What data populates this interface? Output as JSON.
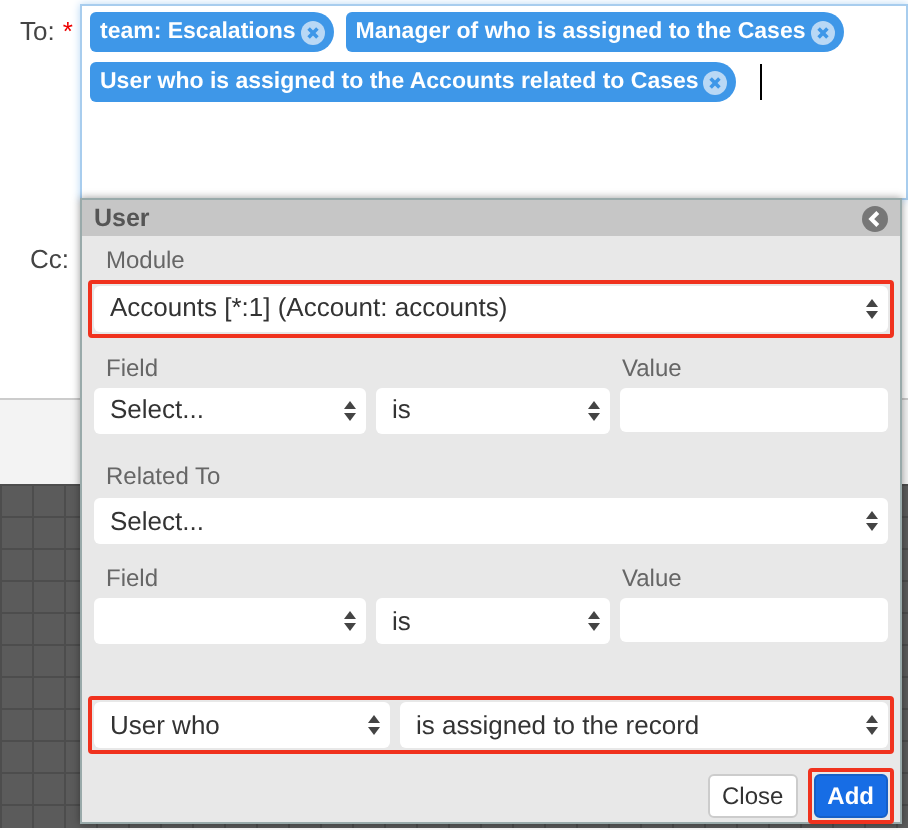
{
  "to": {
    "label": "To:",
    "required_mark": "*",
    "tags": [
      {
        "text": "team: Escalations"
      },
      {
        "text": "Manager of who is assigned to the Cases"
      },
      {
        "text": "User who is assigned to the Accounts related to Cases"
      }
    ]
  },
  "cc": {
    "label": "Cc:"
  },
  "dialog": {
    "title": "User",
    "module": {
      "label": "Module",
      "value": "Accounts [*:1] (Account: accounts)",
      "highlighted": true
    },
    "filter_1": {
      "field_label": "Field",
      "field_value": "Select...",
      "operator": "is",
      "value_label": "Value"
    },
    "related": {
      "label": "Related To",
      "value": "Select..."
    },
    "filter_2": {
      "field_label": "Field",
      "operator": "is",
      "value_label": "Value"
    },
    "user_rule": {
      "left": "User who",
      "right": "is assigned to the record",
      "highlighted": true
    },
    "buttons": [
      {
        "label": "Close",
        "kind": "secondary",
        "highlighted": false
      },
      {
        "label": "Add",
        "kind": "primary",
        "highlighted": true
      }
    ]
  }
}
